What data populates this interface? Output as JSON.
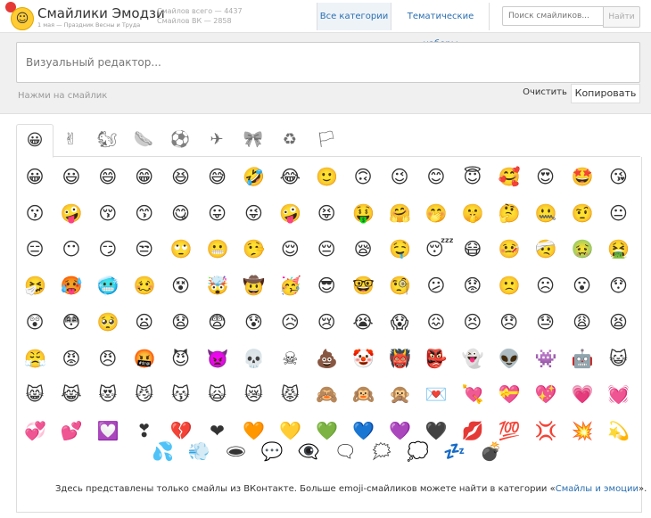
{
  "header": {
    "brand": "Смайлики Эмодзи",
    "brand_sub": "1 мая — Праздник Весны и Труда",
    "stats_total": "Смайлов всего — 4437",
    "stats_vk": "Смайлов ВК — 2858",
    "nav_categories": "Все категории",
    "nav_themes": "Тематические наборы",
    "search_placeholder": "Поиск смайликов...",
    "search_button": "Найти"
  },
  "editor": {
    "placeholder": "Визуальный редактор...",
    "hint": "Нажми на смайлик",
    "clear": "Очистить",
    "copy": "Копировать"
  },
  "tabs": [
    {
      "icon": "😀",
      "name": "tab-smileys"
    },
    {
      "icon": "✌",
      "name": "tab-people"
    },
    {
      "icon": "🐿",
      "name": "tab-animals"
    },
    {
      "icon": "🌭",
      "name": "tab-food"
    },
    {
      "icon": "⚽",
      "name": "tab-activity"
    },
    {
      "icon": "✈",
      "name": "tab-travel"
    },
    {
      "icon": "🎀",
      "name": "tab-objects"
    },
    {
      "icon": "♻",
      "name": "tab-symbols"
    },
    {
      "icon": "🏳",
      "name": "tab-flags"
    }
  ],
  "emoji_rows": [
    [
      "😀",
      "😃",
      "😄",
      "😁",
      "😆",
      "😅",
      "🤣",
      "😂",
      "🙂",
      "🙃",
      "😉",
      "😊",
      "😇",
      "🥰",
      "😍",
      "🤩",
      "😘"
    ],
    [
      "😗",
      "🤪",
      "😚",
      "😙",
      "😋",
      "😛",
      "😜",
      "🤪",
      "😝",
      "🤑",
      "🤗",
      "🤭",
      "🤫",
      "🤔",
      "🤐",
      "🤨",
      "😐"
    ],
    [
      "😑",
      "😶",
      "😏",
      "😒",
      "🙄",
      "😬",
      "🤥",
      "😌",
      "😔",
      "😪",
      "🤤",
      "😴",
      "😷",
      "🤒",
      "🤕",
      "🤢",
      "🤮"
    ],
    [
      "🤧",
      "🥵",
      "🥶",
      "🥴",
      "😵",
      "🤯",
      "🤠",
      "🥳",
      "😎",
      "🤓",
      "🧐",
      "😕",
      "😟",
      "🙁",
      "☹",
      "😮",
      "😯"
    ],
    [
      "😲",
      "😳",
      "🥺",
      "😦",
      "😧",
      "😨",
      "😰",
      "😥",
      "😢",
      "😭",
      "😱",
      "😖",
      "😣",
      "😞",
      "😓",
      "😩",
      "😫"
    ],
    [
      "😤",
      "😡",
      "😠",
      "🤬",
      "😈",
      "👿",
      "💀",
      "☠",
      "💩",
      "🤡",
      "👹",
      "👺",
      "👻",
      "👽",
      "👾",
      "🤖",
      "😺"
    ],
    [
      "😸",
      "😹",
      "😻",
      "😼",
      "😽",
      "🙀",
      "😿",
      "😾",
      "🙈",
      "🙉",
      "🙊",
      "💌",
      "💘",
      "💝",
      "💖",
      "💗",
      "💓"
    ],
    [
      "💞",
      "💕",
      "💟",
      "❣",
      "💔",
      "❤",
      "🧡",
      "💛",
      "💚",
      "💙",
      "💜",
      "🖤",
      "💋",
      "💯",
      "💢",
      "💥",
      "💫"
    ],
    [
      "💦",
      "💨",
      "🕳",
      "💬",
      "👁‍🗨",
      "🗨",
      "🗯",
      "💭",
      "💤",
      "💣"
    ]
  ],
  "footer": {
    "note_before": "Здесь представлены только смайлы из ВКонтакте. Больше emoji-смайликов можете найти в категории «",
    "note_link": "Смайлы и эмоции",
    "note_after": "»."
  }
}
